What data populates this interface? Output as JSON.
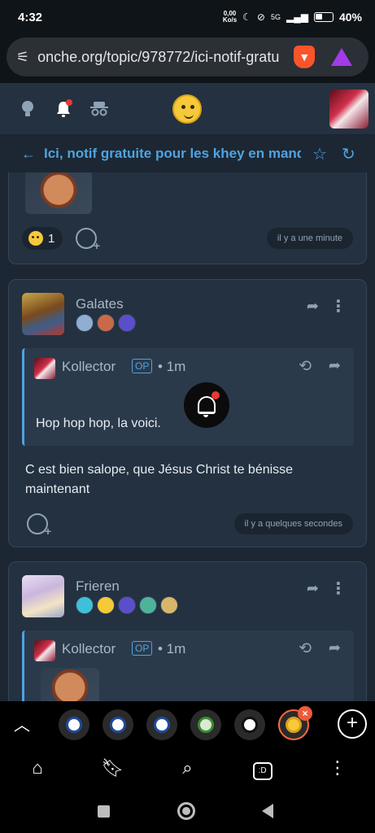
{
  "status_bar": {
    "time": "4:32",
    "net_speed_value": "0,00",
    "net_speed_unit": "Ko/s",
    "network": "5G",
    "battery": "40%"
  },
  "browser": {
    "url": "onche.org/topic/978772/ici-notif-gratu",
    "icons": [
      "tune-icon",
      "brave-lion-icon",
      "brave-rewards-icon"
    ]
  },
  "site_header": {
    "icons": [
      "lightbulb-icon",
      "bell-icon",
      "incognito-icon",
      "onche-smiley-logo",
      "user-avatar"
    ],
    "has_notification": true
  },
  "topic": {
    "title": "Ici, notif gratuite pour les khey en manqu"
  },
  "posts": [
    {
      "reaction_count": "1",
      "timestamp": "il y a une minute"
    },
    {
      "author": "Galates",
      "quote": {
        "author": "Kollector",
        "op_label": "OP",
        "time": "• 1m",
        "text": "Hop hop hop, la voici."
      },
      "text": "C est bien salope, que Jésus Christ te bénisse maintenant",
      "timestamp": "il y a quelques secondes"
    },
    {
      "author": "Frieren",
      "quote": {
        "author": "Kollector",
        "op_label": "OP",
        "time": "• 1m"
      }
    }
  ],
  "tab_strip": {
    "add_label": "+",
    "close_label": "×"
  },
  "bottom_nav": {
    "tabs_label": ":D"
  },
  "colors": {
    "background": "#1c2733",
    "card": "#243140",
    "accent": "#4fa3e0",
    "notification": "#e53935"
  }
}
